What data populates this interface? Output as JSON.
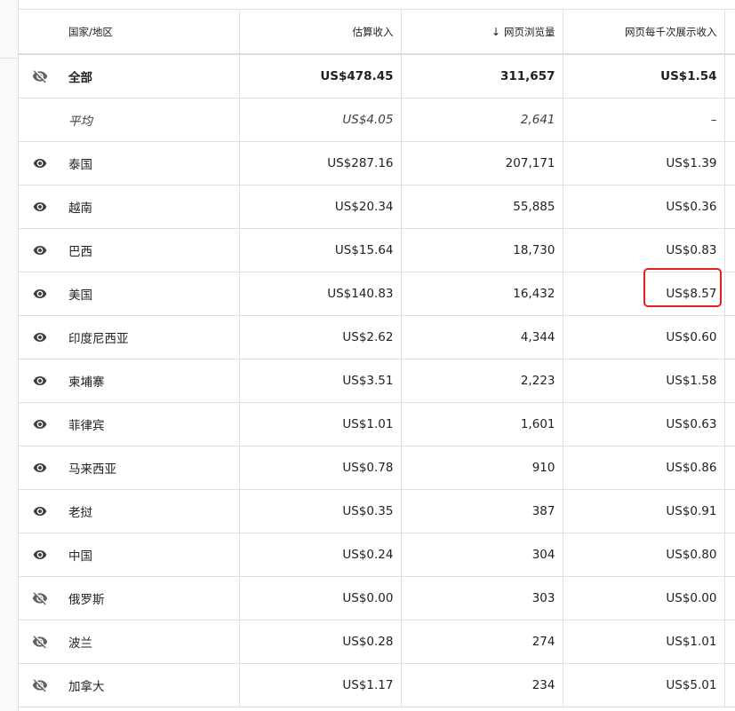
{
  "headers": {
    "country": "国家/地区",
    "revenue": "估算收入",
    "pageviews": "网页浏览量",
    "rpm": "网页每千次展示收入"
  },
  "sort": {
    "column": "pageviews",
    "direction": "descending"
  },
  "highlight_color": "#e02020",
  "rows": [
    {
      "visible": false,
      "country": "全部",
      "revenue": "US$478.45",
      "pageviews": "311,657",
      "rpm": "US$1.54",
      "kind": "total"
    },
    {
      "visible": null,
      "country": "平均",
      "revenue": "US$4.05",
      "pageviews": "2,641",
      "rpm": "–",
      "kind": "average"
    },
    {
      "visible": true,
      "country": "泰国",
      "revenue": "US$287.16",
      "pageviews": "207,171",
      "rpm": "US$1.39"
    },
    {
      "visible": true,
      "country": "越南",
      "revenue": "US$20.34",
      "pageviews": "55,885",
      "rpm": "US$0.36"
    },
    {
      "visible": true,
      "country": "巴西",
      "revenue": "US$15.64",
      "pageviews": "18,730",
      "rpm": "US$0.83"
    },
    {
      "visible": true,
      "country": "美国",
      "revenue": "US$140.83",
      "pageviews": "16,432",
      "rpm": "US$8.57",
      "highlighted": true
    },
    {
      "visible": true,
      "country": "印度尼西亚",
      "revenue": "US$2.62",
      "pageviews": "4,344",
      "rpm": "US$0.60"
    },
    {
      "visible": true,
      "country": "柬埔寨",
      "revenue": "US$3.51",
      "pageviews": "2,223",
      "rpm": "US$1.58"
    },
    {
      "visible": true,
      "country": "菲律宾",
      "revenue": "US$1.01",
      "pageviews": "1,601",
      "rpm": "US$0.63"
    },
    {
      "visible": true,
      "country": "马来西亚",
      "revenue": "US$0.78",
      "pageviews": "910",
      "rpm": "US$0.86"
    },
    {
      "visible": true,
      "country": "老挝",
      "revenue": "US$0.35",
      "pageviews": "387",
      "rpm": "US$0.91"
    },
    {
      "visible": true,
      "country": "中国",
      "revenue": "US$0.24",
      "pageviews": "304",
      "rpm": "US$0.80"
    },
    {
      "visible": false,
      "country": "俄罗斯",
      "revenue": "US$0.00",
      "pageviews": "303",
      "rpm": "US$0.00"
    },
    {
      "visible": false,
      "country": "波兰",
      "revenue": "US$0.28",
      "pageviews": "274",
      "rpm": "US$1.01"
    },
    {
      "visible": false,
      "country": "加拿大",
      "revenue": "US$1.17",
      "pageviews": "234",
      "rpm": "US$5.01"
    }
  ]
}
